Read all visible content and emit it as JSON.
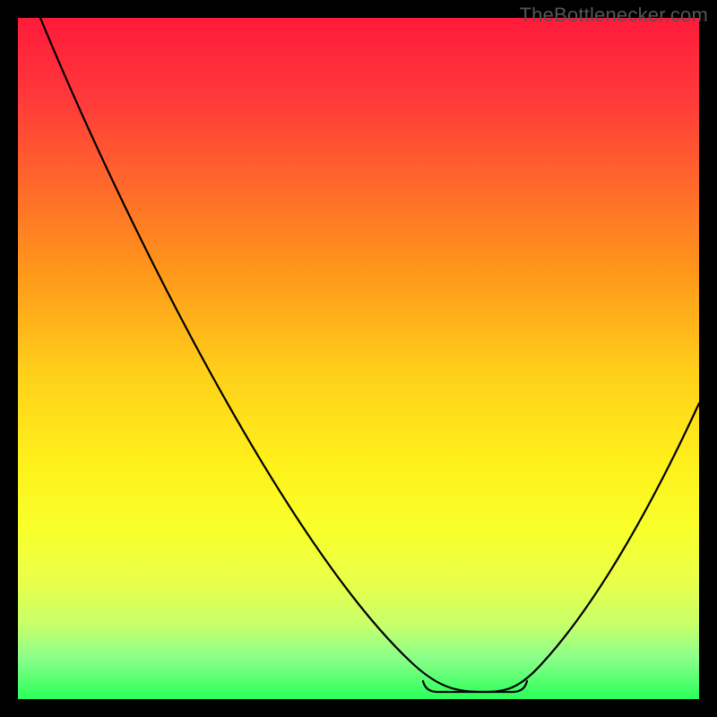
{
  "attribution": "TheBottlenecker.com",
  "chart_data": {
    "type": "line",
    "title": "",
    "xlabel": "",
    "ylabel": "",
    "xlim": [
      0,
      100
    ],
    "ylim": [
      0,
      100
    ],
    "x": [
      0,
      5,
      10,
      15,
      20,
      25,
      30,
      35,
      40,
      45,
      50,
      55,
      60,
      62,
      65,
      68,
      70,
      72,
      75,
      80,
      85,
      90,
      95,
      100
    ],
    "values": [
      100,
      92,
      84,
      76,
      68,
      60,
      52,
      44,
      36,
      28,
      20,
      13,
      6,
      3,
      1,
      0,
      0,
      0,
      1,
      5,
      12,
      22,
      33,
      45
    ],
    "flat_region": {
      "x_start": 62,
      "x_end": 75,
      "y": 0
    },
    "gradient": [
      "#ff1a3a",
      "#fff01a",
      "#2aff5a"
    ]
  }
}
